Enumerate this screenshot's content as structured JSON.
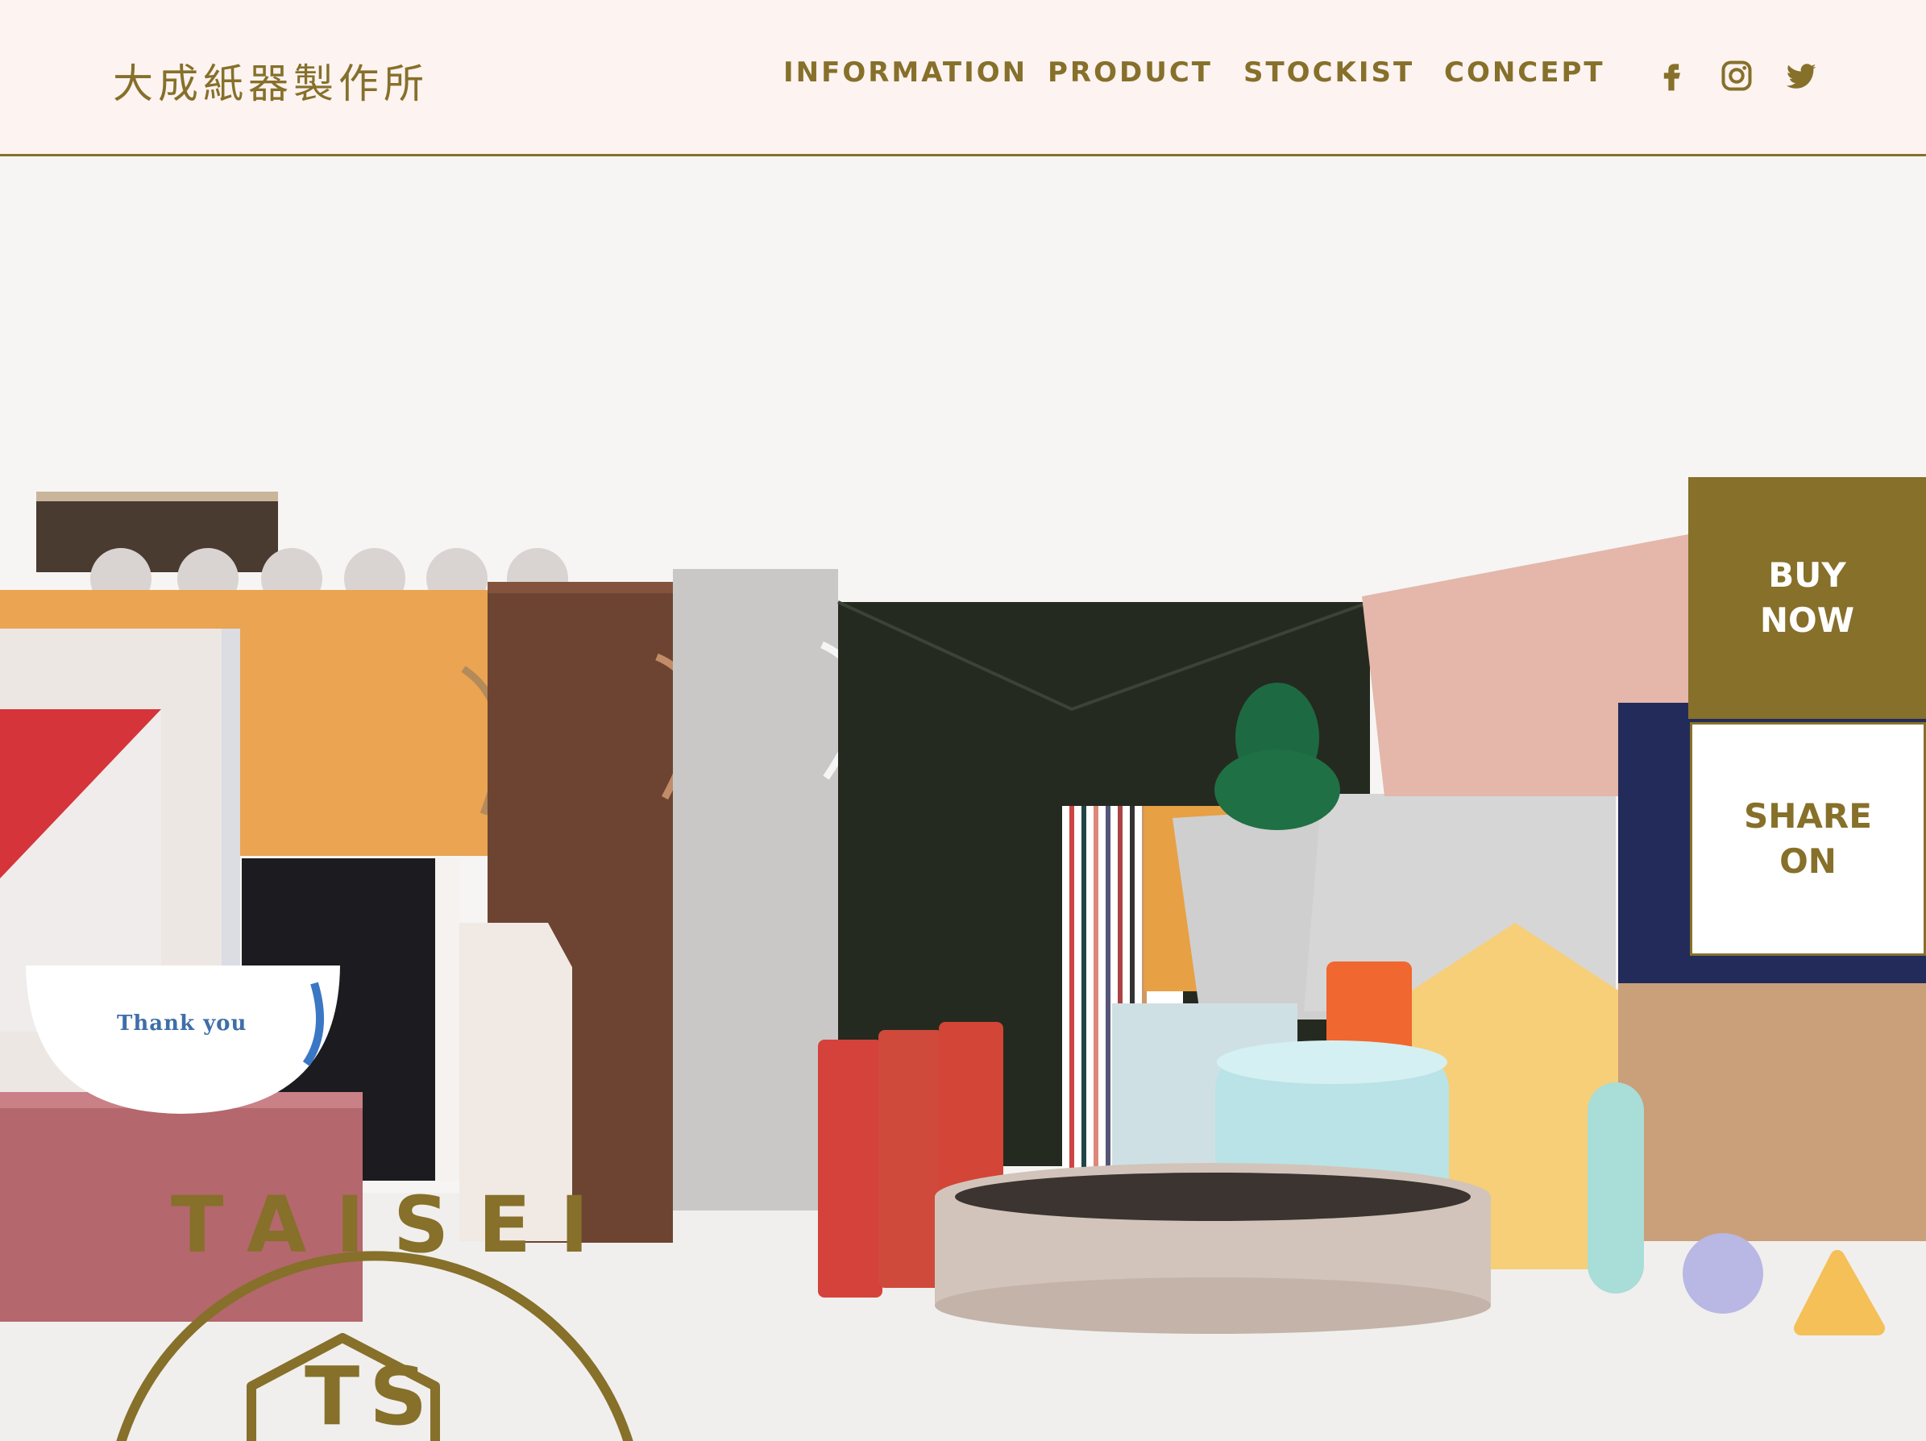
{
  "header": {
    "logo": "大成紙器製作所",
    "nav": [
      "INFORMATION",
      "PRODUCT",
      "STOCKIST",
      "CONCEPT"
    ],
    "social": [
      "facebook-icon",
      "instagram-icon",
      "twitter-icon"
    ]
  },
  "hero": {
    "card_text": "Thank you",
    "emblem_top": "TAISEI",
    "emblem_mark": "TS"
  },
  "side": {
    "buy_line1": "BUY",
    "buy_line2": "NOW",
    "share_line1": "SHARE",
    "share_line2": "ON"
  },
  "colors": {
    "accent": "#86702a",
    "header_bg": "#fdf3f1"
  }
}
